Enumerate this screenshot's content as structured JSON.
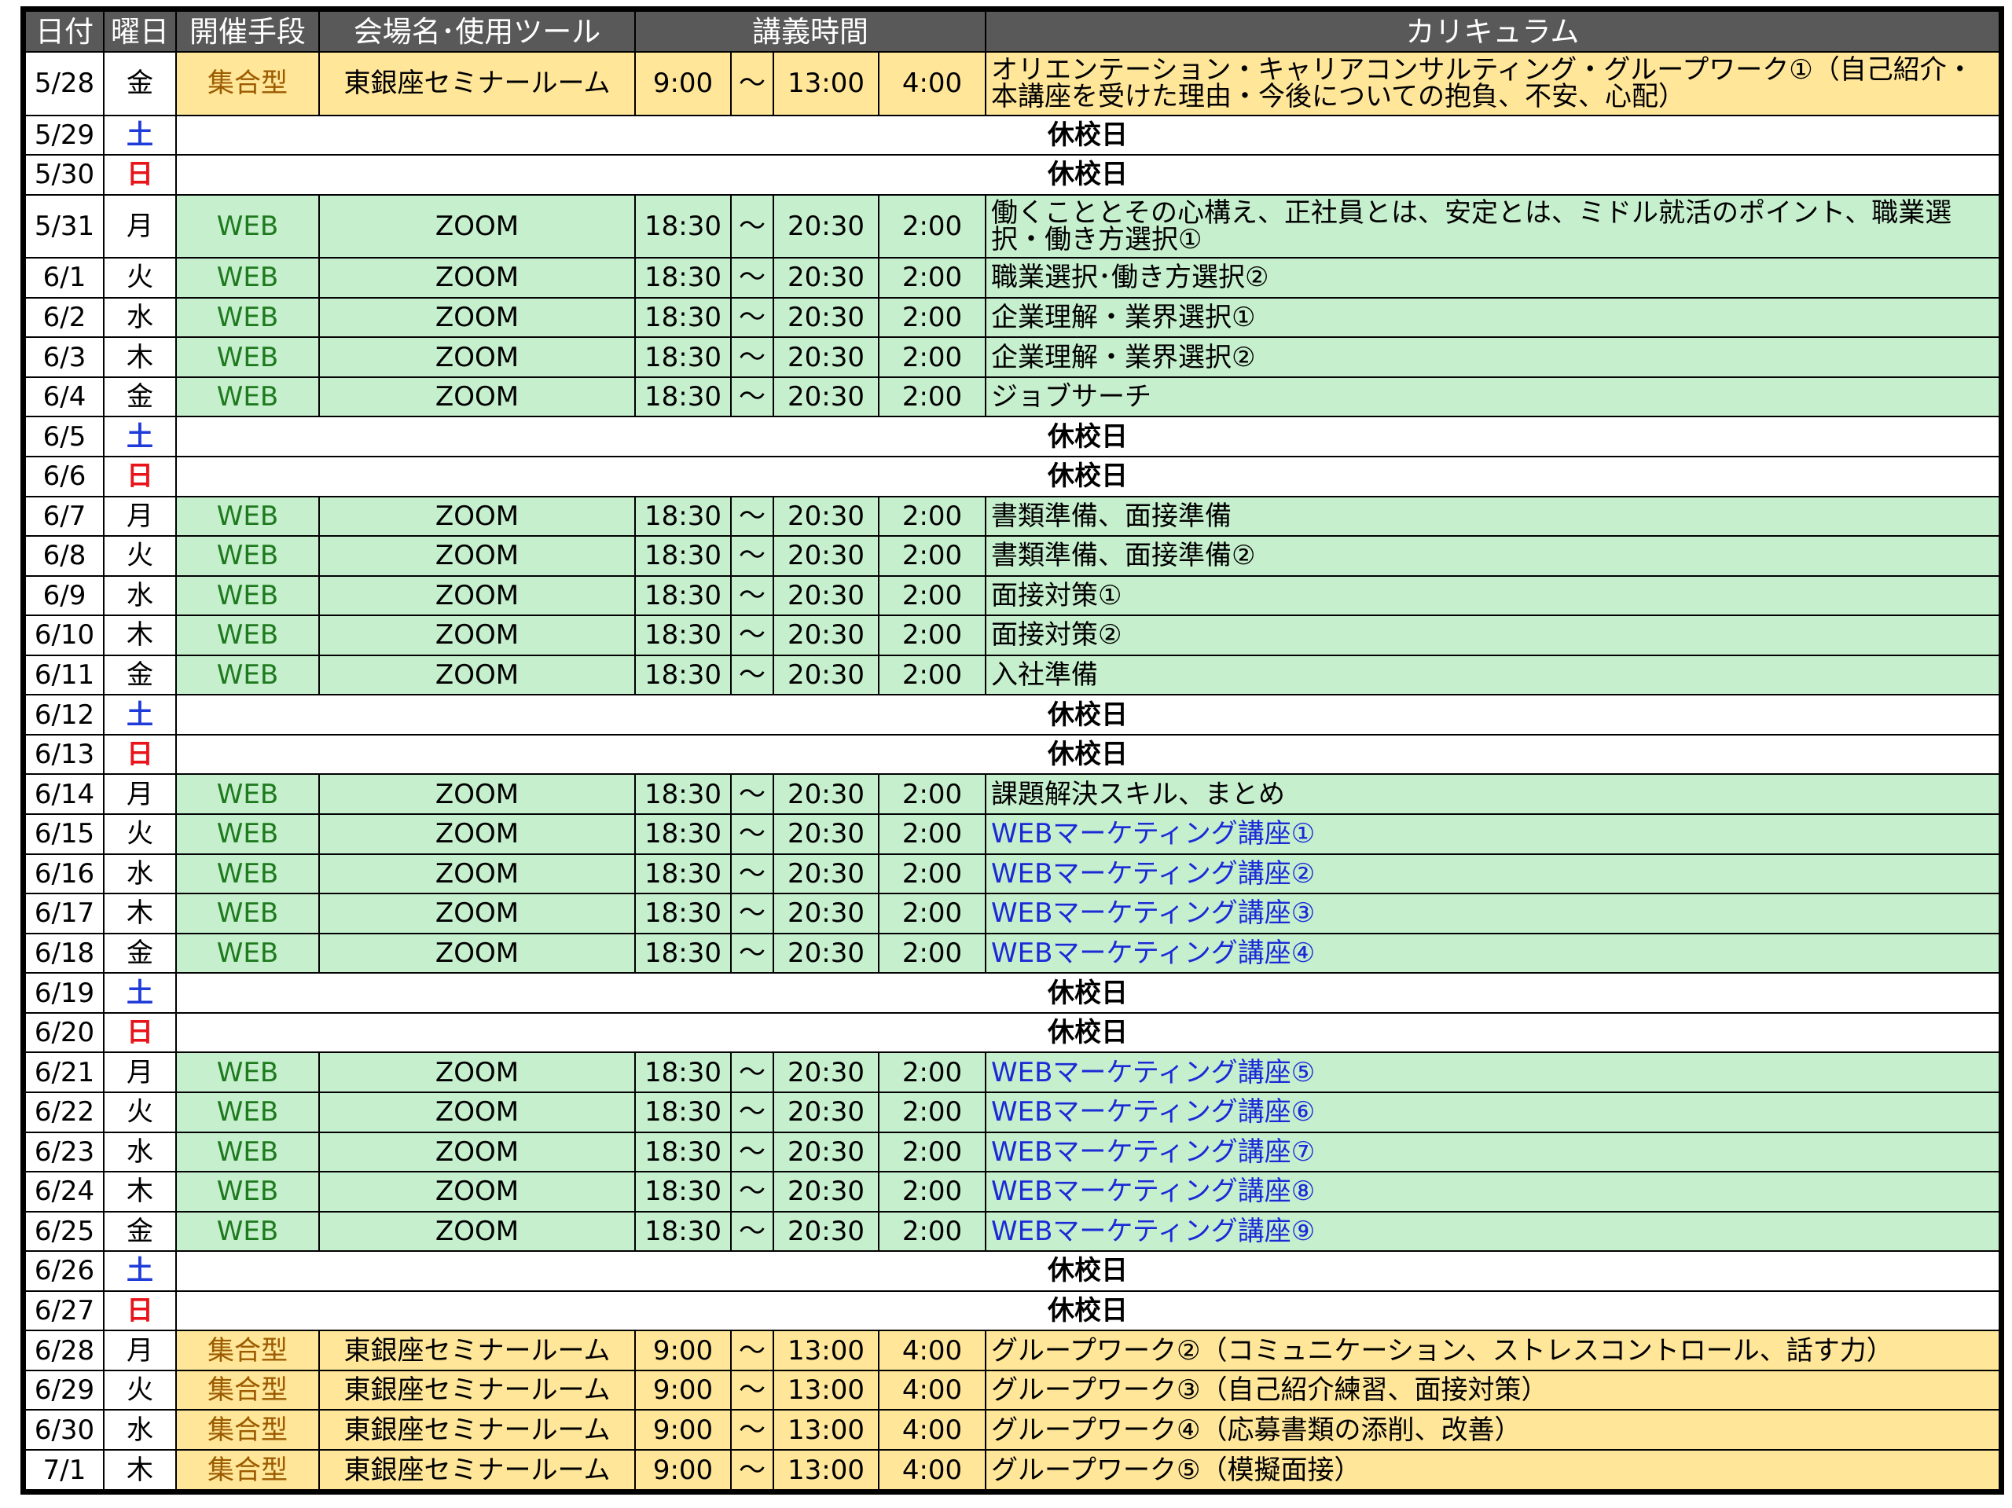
{
  "colors": {
    "header_bg": "#595959",
    "web_row_bg": "#c6efce",
    "group_row_bg": "#ffe699",
    "saturday": "#1f3bd8",
    "sunday": "#e8141a",
    "web_text": "#1f7a1f",
    "group_text": "#9c5b00",
    "marketing_text": "#1a2bd6"
  },
  "header": {
    "date": "日付",
    "day": "曜日",
    "method": "開催手段",
    "venue": "会場名･使用ツール",
    "time": "講義時間",
    "curriculum": "カリキュラム"
  },
  "rows": [
    {
      "kind": "group",
      "date": "5/28",
      "day": "金",
      "method": "集合型",
      "venue": "東銀座セミナールーム",
      "start": "9:00",
      "sep": "～",
      "end": "13:00",
      "hours": "4:00",
      "curriculum": "オリエンテーション・キャリアコンサルティング・グループワーク①（自己紹介・本講座を受けた理由・今後についての抱負、不安、心配）"
    },
    {
      "kind": "holiday",
      "date": "5/29",
      "day": "土",
      "label": "休校日"
    },
    {
      "kind": "holiday",
      "date": "5/30",
      "day": "日",
      "label": "休校日"
    },
    {
      "kind": "web",
      "date": "5/31",
      "day": "月",
      "method": "WEB",
      "venue": "ZOOM",
      "start": "18:30",
      "sep": "～",
      "end": "20:30",
      "hours": "2:00",
      "curriculum": "働くこととその心構え、正社員とは、安定とは、ミドル就活のポイント、職業選択・働き方選択①"
    },
    {
      "kind": "web",
      "date": "6/1",
      "day": "火",
      "method": "WEB",
      "venue": "ZOOM",
      "start": "18:30",
      "sep": "～",
      "end": "20:30",
      "hours": "2:00",
      "curriculum": "職業選択･働き方選択②"
    },
    {
      "kind": "web",
      "date": "6/2",
      "day": "水",
      "method": "WEB",
      "venue": "ZOOM",
      "start": "18:30",
      "sep": "～",
      "end": "20:30",
      "hours": "2:00",
      "curriculum": "企業理解・業界選択①"
    },
    {
      "kind": "web",
      "date": "6/3",
      "day": "木",
      "method": "WEB",
      "venue": "ZOOM",
      "start": "18:30",
      "sep": "～",
      "end": "20:30",
      "hours": "2:00",
      "curriculum": "企業理解・業界選択②"
    },
    {
      "kind": "web",
      "date": "6/4",
      "day": "金",
      "method": "WEB",
      "venue": "ZOOM",
      "start": "18:30",
      "sep": "～",
      "end": "20:30",
      "hours": "2:00",
      "curriculum": "ジョブサーチ"
    },
    {
      "kind": "holiday",
      "date": "6/5",
      "day": "土",
      "label": "休校日"
    },
    {
      "kind": "holiday",
      "date": "6/6",
      "day": "日",
      "label": "休校日"
    },
    {
      "kind": "web",
      "date": "6/7",
      "day": "月",
      "method": "WEB",
      "venue": "ZOOM",
      "start": "18:30",
      "sep": "～",
      "end": "20:30",
      "hours": "2:00",
      "curriculum": "書類準備、面接準備"
    },
    {
      "kind": "web",
      "date": "6/8",
      "day": "火",
      "method": "WEB",
      "venue": "ZOOM",
      "start": "18:30",
      "sep": "～",
      "end": "20:30",
      "hours": "2:00",
      "curriculum": "書類準備、面接準備②"
    },
    {
      "kind": "web",
      "date": "6/9",
      "day": "水",
      "method": "WEB",
      "venue": "ZOOM",
      "start": "18:30",
      "sep": "～",
      "end": "20:30",
      "hours": "2:00",
      "curriculum": "面接対策①"
    },
    {
      "kind": "web",
      "date": "6/10",
      "day": "木",
      "method": "WEB",
      "venue": "ZOOM",
      "start": "18:30",
      "sep": "～",
      "end": "20:30",
      "hours": "2:00",
      "curriculum": "面接対策②"
    },
    {
      "kind": "web",
      "date": "6/11",
      "day": "金",
      "method": "WEB",
      "venue": "ZOOM",
      "start": "18:30",
      "sep": "～",
      "end": "20:30",
      "hours": "2:00",
      "curriculum": "入社準備"
    },
    {
      "kind": "holiday",
      "date": "6/12",
      "day": "土",
      "label": "休校日"
    },
    {
      "kind": "holiday",
      "date": "6/13",
      "day": "日",
      "label": "休校日"
    },
    {
      "kind": "web",
      "date": "6/14",
      "day": "月",
      "method": "WEB",
      "venue": "ZOOM",
      "start": "18:30",
      "sep": "～",
      "end": "20:30",
      "hours": "2:00",
      "curriculum": "課題解決スキル、まとめ"
    },
    {
      "kind": "web",
      "blue": true,
      "date": "6/15",
      "day": "火",
      "method": "WEB",
      "venue": "ZOOM",
      "start": "18:30",
      "sep": "～",
      "end": "20:30",
      "hours": "2:00",
      "curriculum": "WEBマーケティング講座①"
    },
    {
      "kind": "web",
      "blue": true,
      "date": "6/16",
      "day": "水",
      "method": "WEB",
      "venue": "ZOOM",
      "start": "18:30",
      "sep": "～",
      "end": "20:30",
      "hours": "2:00",
      "curriculum": "WEBマーケティング講座②"
    },
    {
      "kind": "web",
      "blue": true,
      "date": "6/17",
      "day": "木",
      "method": "WEB",
      "venue": "ZOOM",
      "start": "18:30",
      "sep": "～",
      "end": "20:30",
      "hours": "2:00",
      "curriculum": "WEBマーケティング講座③"
    },
    {
      "kind": "web",
      "blue": true,
      "date": "6/18",
      "day": "金",
      "method": "WEB",
      "venue": "ZOOM",
      "start": "18:30",
      "sep": "～",
      "end": "20:30",
      "hours": "2:00",
      "curriculum": "WEBマーケティング講座④"
    },
    {
      "kind": "holiday",
      "date": "6/19",
      "day": "土",
      "label": "休校日"
    },
    {
      "kind": "holiday",
      "date": "6/20",
      "day": "日",
      "label": "休校日"
    },
    {
      "kind": "web",
      "blue": true,
      "date": "6/21",
      "day": "月",
      "method": "WEB",
      "venue": "ZOOM",
      "start": "18:30",
      "sep": "～",
      "end": "20:30",
      "hours": "2:00",
      "curriculum": "WEBマーケティング講座⑤"
    },
    {
      "kind": "web",
      "blue": true,
      "date": "6/22",
      "day": "火",
      "method": "WEB",
      "venue": "ZOOM",
      "start": "18:30",
      "sep": "～",
      "end": "20:30",
      "hours": "2:00",
      "curriculum": "WEBマーケティング講座⑥"
    },
    {
      "kind": "web",
      "blue": true,
      "date": "6/23",
      "day": "水",
      "method": "WEB",
      "venue": "ZOOM",
      "start": "18:30",
      "sep": "～",
      "end": "20:30",
      "hours": "2:00",
      "curriculum": "WEBマーケティング講座⑦"
    },
    {
      "kind": "web",
      "blue": true,
      "date": "6/24",
      "day": "木",
      "method": "WEB",
      "venue": "ZOOM",
      "start": "18:30",
      "sep": "～",
      "end": "20:30",
      "hours": "2:00",
      "curriculum": "WEBマーケティング講座⑧"
    },
    {
      "kind": "web",
      "blue": true,
      "date": "6/25",
      "day": "金",
      "method": "WEB",
      "venue": "ZOOM",
      "start": "18:30",
      "sep": "～",
      "end": "20:30",
      "hours": "2:00",
      "curriculum": "WEBマーケティング講座⑨"
    },
    {
      "kind": "holiday",
      "date": "6/26",
      "day": "土",
      "label": "休校日"
    },
    {
      "kind": "holiday",
      "date": "6/27",
      "day": "日",
      "label": "休校日"
    },
    {
      "kind": "group",
      "date": "6/28",
      "day": "月",
      "method": "集合型",
      "venue": "東銀座セミナールーム",
      "start": "9:00",
      "sep": "～",
      "end": "13:00",
      "hours": "4:00",
      "curriculum": "グループワーク②（コミュニケーション、ストレスコントロール、話す力）"
    },
    {
      "kind": "group",
      "date": "6/29",
      "day": "火",
      "method": "集合型",
      "venue": "東銀座セミナールーム",
      "start": "9:00",
      "sep": "～",
      "end": "13:00",
      "hours": "4:00",
      "curriculum": "グループワーク③（自己紹介練習、面接対策）"
    },
    {
      "kind": "group",
      "date": "6/30",
      "day": "水",
      "method": "集合型",
      "venue": "東銀座セミナールーム",
      "start": "9:00",
      "sep": "～",
      "end": "13:00",
      "hours": "4:00",
      "curriculum": "グループワーク④（応募書類の添削、改善）"
    },
    {
      "kind": "group",
      "date": "7/1",
      "day": "木",
      "method": "集合型",
      "venue": "東銀座セミナールーム",
      "start": "9:00",
      "sep": "～",
      "end": "13:00",
      "hours": "4:00",
      "curriculum": "グループワーク⑤（模擬面接）"
    }
  ]
}
